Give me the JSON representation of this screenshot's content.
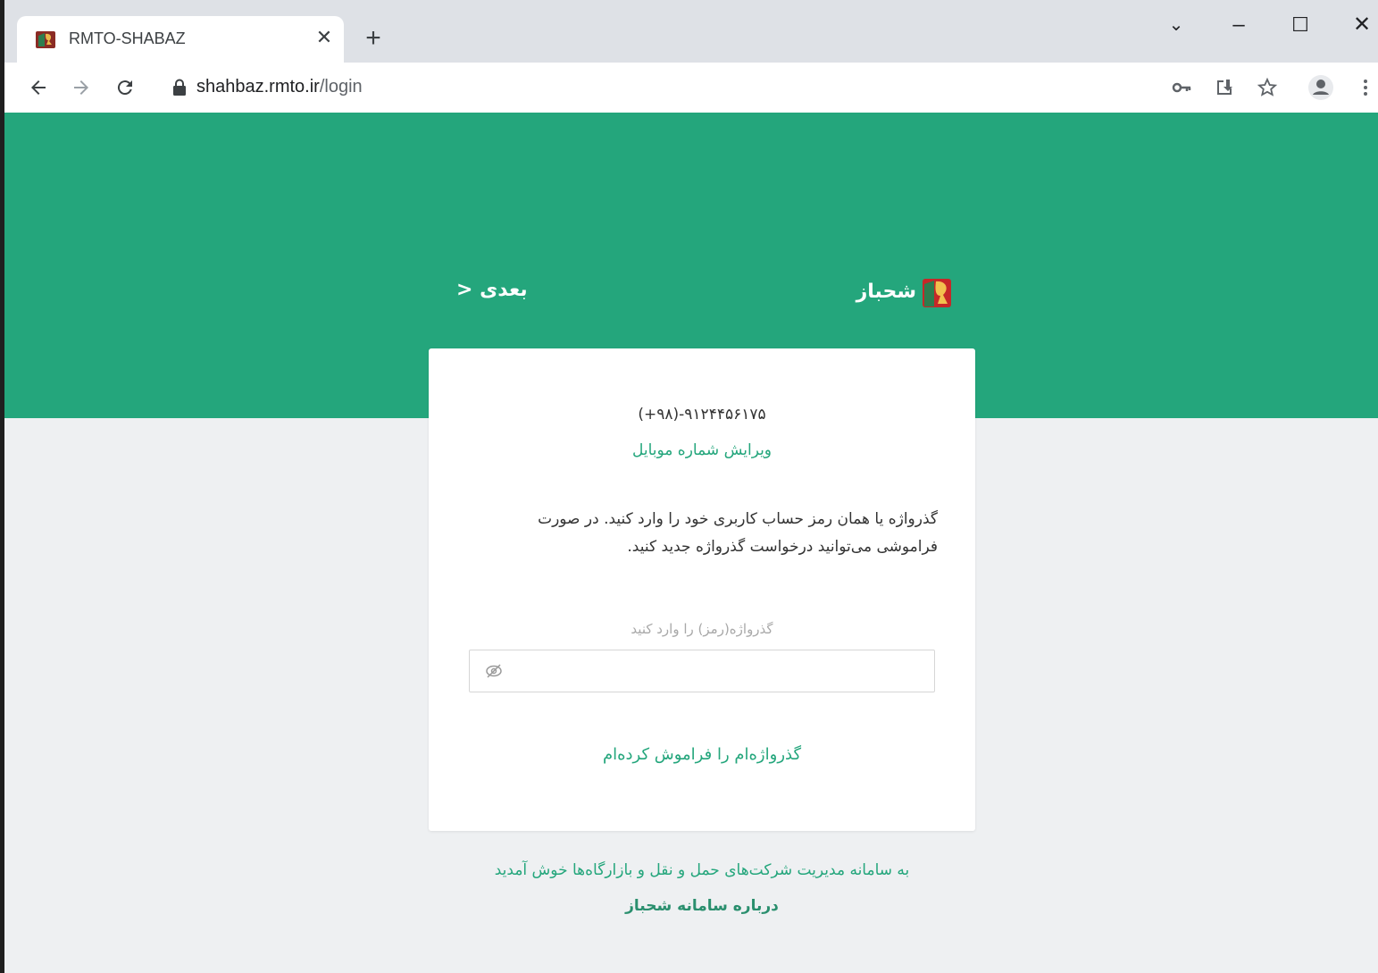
{
  "browser": {
    "tab_title": "RMTO-SHABAZ",
    "tab_close": "✕",
    "new_tab": "+",
    "url_host": "shahbaz.rmto.ir",
    "url_path": "/login",
    "window_controls": {
      "tab_search": "⌄",
      "minimize": "–",
      "maximize": "☐",
      "close": "✕"
    }
  },
  "header": {
    "brand_name": "شحباز",
    "next_label": "بعدی <"
  },
  "login_card": {
    "phone_number": "(+۹۸)-۹۱۲۴۴۵۶۱۷۵",
    "edit_phone_label": "ویرایش شماره موبایل",
    "instruction": "گذرواژه یا همان رمز حساب کاربری خود را وارد کنید. در صورت فراموشی می‌توانید درخواست گذرواژه جدید کنید.",
    "password_label": "گذرواژه(رمز) را وارد کنید",
    "password_value": "",
    "forgot_label": "گذرواژه‌ام را فراموش کرده‌ام"
  },
  "footer": {
    "welcome_text": "به سامانه مدیریت شرکت‌های حمل و نقل و بازارگاه‌ها خوش آمدید",
    "about_link": "درباره سامانه شحباز"
  },
  "colors": {
    "brand_green": "#24a67c",
    "page_bg": "#eef0f2",
    "card_bg": "#ffffff"
  },
  "icons": {
    "back": "arrow-left-icon",
    "forward": "arrow-right-icon",
    "reload": "reload-icon",
    "lock": "lock-icon",
    "key": "key-icon",
    "install": "install-icon",
    "bookmark": "star-icon",
    "profile": "profile-icon",
    "menu": "kebab-menu-icon",
    "password_visibility": "eye-off-icon"
  }
}
